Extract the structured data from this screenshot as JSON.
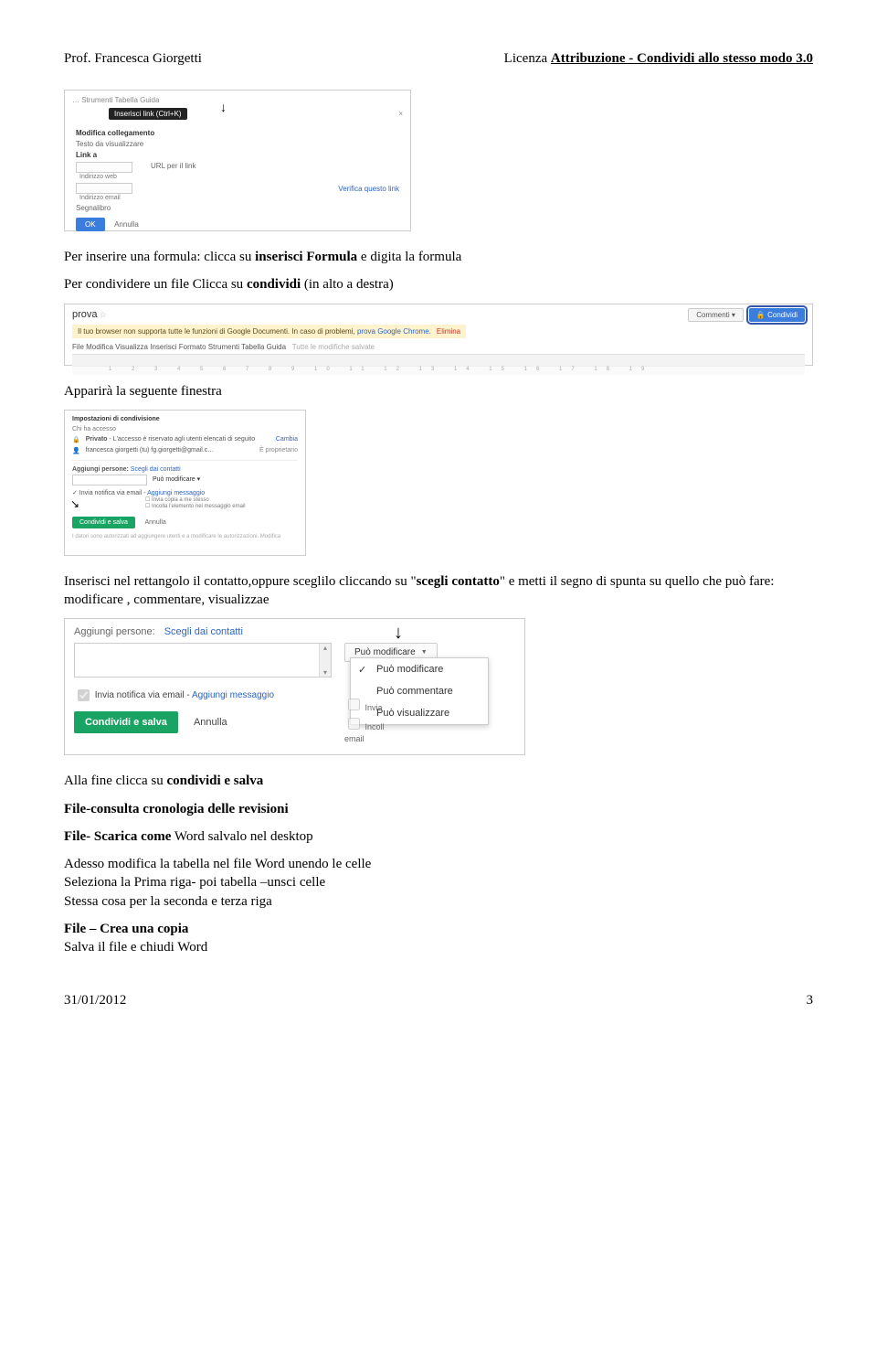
{
  "header": {
    "left": "Prof. Francesca Giorgetti",
    "right_prefix": "Licenza ",
    "right_bold": "Attribuzione - Condividi allo stesso modo 3.0"
  },
  "fig1": {
    "menubar": "…  Strumenti   Tabella   Guida",
    "tooltip": "Inserisci link (Ctrl+K)",
    "lbl_modifica": "Modifica collegamento",
    "lbl_testo": "Testo da visualizzare",
    "lbl_linka": "Link a",
    "lbl_url": "URL per il link",
    "indirizzo_web": "Indirizzo web",
    "indirizzo_email": "Indirizzo email",
    "verifica": "Verifica questo link",
    "segnalibro": "Segnalibro",
    "ok": "OK",
    "annulla": "Annulla"
  },
  "para1_pre": "Per inserire una formula: clicca su ",
  "para1_b": "inserisci Formula",
  "para1_post": " e digita la formula",
  "para2_pre": "Per condividere un file  Clicca su ",
  "para2_b": "condividi",
  "para2_post": " (in alto a destra)",
  "fig2": {
    "title": "prova",
    "commenti": "Commenti",
    "condividi": "Condividi",
    "warn_main": "Il tuo browser non supporta tutte le funzioni di Google Documenti. In caso di problemi, ",
    "warn_link": "prova Google Chrome.",
    "warn_elim": "Elimina",
    "menu": "File   Modifica   Visualizza   Inserisci   Formato   Strumenti   Tabella   Guida",
    "menu_dim": "Tutte le modifiche salvate"
  },
  "para3": "Apparirà la seguente finestra",
  "fig3": {
    "t1": "Impostazioni di condivisione",
    "t2": "Chi ha accesso",
    "privato_b": "Privato",
    "privato_rest": " - L'accesso è riservato agli utenti elencati di seguito",
    "cambia": "Cambia",
    "owner": "francesca giorgetti (tu)  fg.giorgetti@gmail.c…",
    "prop": "È proprietario",
    "aggiungi_b": "Aggiungi persone:",
    "aggiungi_rest": " Scegli dai contatti",
    "dd": "Può modificare ▾",
    "invia": "✓ Invia notifica via email - ",
    "agg_msg": "Aggiungi messaggio",
    "chk1": "☐ Invia copia a me stesso",
    "chk2": "☐ Incolla l'elemento nel messaggio email",
    "grn": "Condividi e salva",
    "ann": "Annulla",
    "foot": "I datori sono autorizzati ad aggiungere utenti e a modificare le autorizzazioni.  Modifica"
  },
  "para4_pre": "Inserisci nel rettangolo il contatto,oppure sceglilo cliccando su \"",
  "para4_b": "scegli contatto",
  "para4_post": " e metti il segno di spunta su quello che può fare: modificare , commentare, visualizzae",
  "fig4": {
    "lbl": "Aggiungi persone:",
    "bluelbl": "Scegli dai contatti",
    "dd_btn": "Può modificare",
    "dd1": "Può modificare",
    "dd2": "Può commentare",
    "dd3": "Può visualizzare",
    "chk_invia": "Invia notifica via email - ",
    "chk_linkadd": "Aggiungi messaggio",
    "side1": "Invia",
    "side2": "Incoll",
    "side3": "email",
    "grn": "Condividi e salva",
    "ann": "Annulla"
  },
  "para5_pre": "Alla fine clicca su ",
  "para5_b": "condividi e salva",
  "para6": "File-consulta cronologia delle revisioni",
  "para7_b": "File- Scarica come",
  "para7_post": " Word  salvalo nel desktop",
  "para8": "Adesso modifica la tabella nel file Word unendo le celle",
  "para9": "Seleziona la Prima riga- poi tabella –unsci celle",
  "para10": "Stessa cosa per la seconda e terza riga",
  "para11": "File – Crea una copia",
  "para12": "Salva il file e chiudi Word",
  "footer": {
    "date": "31/01/2012",
    "page": "3"
  }
}
